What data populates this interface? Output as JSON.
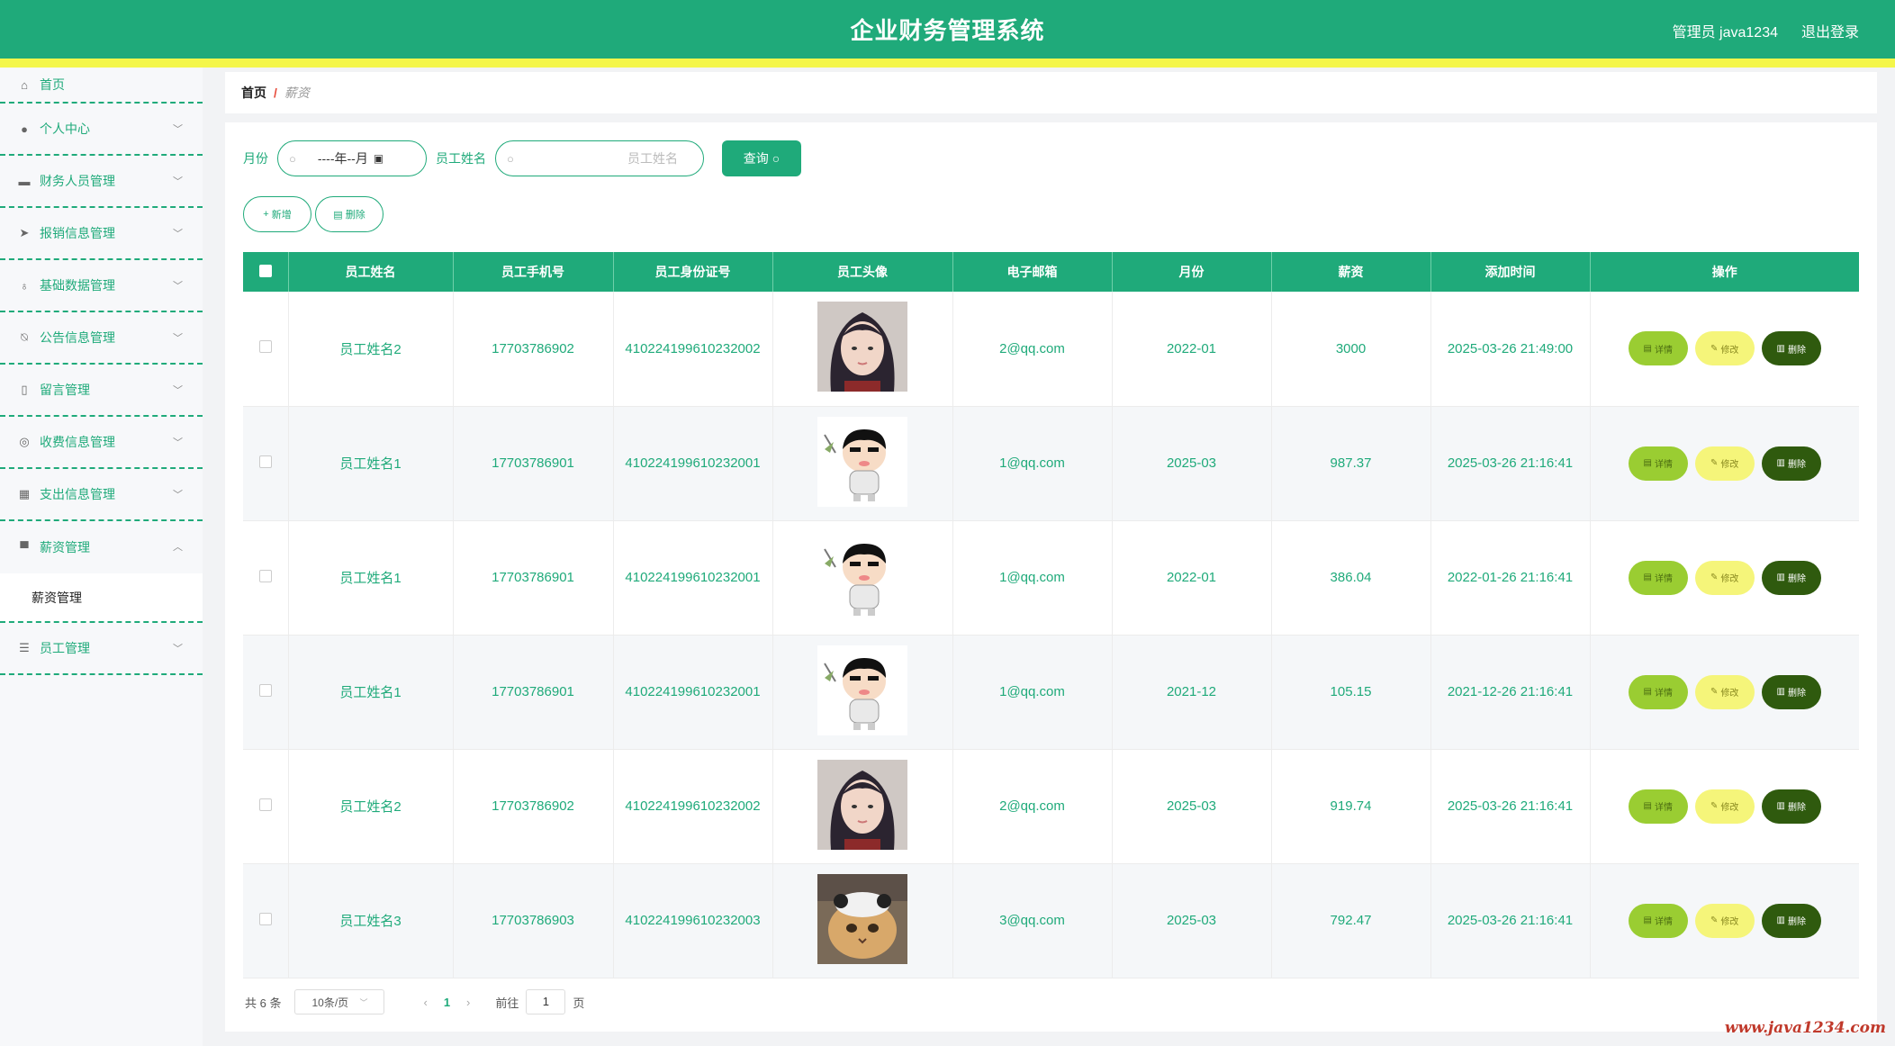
{
  "header": {
    "title": "企业财务管理系统",
    "user": "管理员 java1234",
    "logout": "退出登录"
  },
  "sidebar": {
    "items": [
      {
        "label": "首页",
        "icon": "home-icon"
      },
      {
        "label": "个人中心",
        "icon": "user-icon"
      },
      {
        "label": "财务人员管理",
        "icon": "ticket-icon"
      },
      {
        "label": "报销信息管理",
        "icon": "send-icon"
      },
      {
        "label": "基础数据管理",
        "icon": "microphone-icon"
      },
      {
        "label": "公告信息管理",
        "icon": "bell-off-icon"
      },
      {
        "label": "留言管理",
        "icon": "phone-icon"
      },
      {
        "label": "收费信息管理",
        "icon": "compass-icon"
      },
      {
        "label": "支出信息管理",
        "icon": "grid-icon"
      },
      {
        "label": "薪资管理",
        "icon": "printer-icon"
      },
      {
        "label": "员工管理",
        "icon": "list-icon"
      }
    ],
    "sub_salary": "薪资管理"
  },
  "breadcrumb": {
    "home": "首页",
    "sep": "/",
    "current": "薪资"
  },
  "search": {
    "month_label": "月份",
    "month_value": "----年--月",
    "name_label": "员工姓名",
    "name_placeholder": "员工姓名",
    "query": "查询"
  },
  "actions": {
    "add": "新增",
    "delete": "删除"
  },
  "table": {
    "headers": [
      "员工姓名",
      "员工手机号",
      "员工身份证号",
      "员工头像",
      "电子邮箱",
      "月份",
      "薪资",
      "添加时间",
      "操作"
    ],
    "rows": [
      {
        "name": "员工姓名2",
        "phone": "17703786902",
        "idcard": "410224199610232002",
        "avatar": "girl",
        "email": "2@qq.com",
        "month": "2022-01",
        "salary": "3000",
        "time": "2025-03-26 21:49:00"
      },
      {
        "name": "员工姓名1",
        "phone": "17703786901",
        "idcard": "410224199610232001",
        "avatar": "cartoon",
        "email": "1@qq.com",
        "month": "2025-03",
        "salary": "987.37",
        "time": "2025-03-26 21:16:41"
      },
      {
        "name": "员工姓名1",
        "phone": "17703786901",
        "idcard": "410224199610232001",
        "avatar": "cartoon",
        "email": "1@qq.com",
        "month": "2022-01",
        "salary": "386.04",
        "time": "2022-01-26 21:16:41"
      },
      {
        "name": "员工姓名1",
        "phone": "17703786901",
        "idcard": "410224199610232001",
        "avatar": "cartoon",
        "email": "1@qq.com",
        "month": "2021-12",
        "salary": "105.15",
        "time": "2021-12-26 21:16:41"
      },
      {
        "name": "员工姓名2",
        "phone": "17703786902",
        "idcard": "410224199610232002",
        "avatar": "girl",
        "email": "2@qq.com",
        "month": "2025-03",
        "salary": "919.74",
        "time": "2025-03-26 21:16:41"
      },
      {
        "name": "员工姓名3",
        "phone": "17703786903",
        "idcard": "410224199610232003",
        "avatar": "cat",
        "email": "3@qq.com",
        "month": "2025-03",
        "salary": "792.47",
        "time": "2025-03-26 21:16:41"
      }
    ],
    "ops": {
      "detail": "详情",
      "edit": "修改",
      "delete": "删除"
    }
  },
  "pager": {
    "total": "共 6 条",
    "size": "10条/页",
    "page": "1",
    "goto_label": "前往",
    "goto_value": "1",
    "page_suffix": "页"
  },
  "watermark": "www.java1234.com",
  "colors": {
    "primary": "#1faa7a",
    "stripe": "#f4f64a",
    "detail": "#9acd32",
    "edit": "#f5f57a",
    "delete": "#2f5a0e"
  }
}
